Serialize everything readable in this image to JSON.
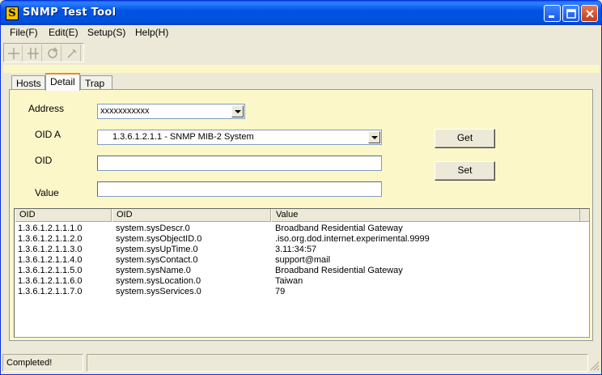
{
  "window": {
    "title": "SNMP Test Tool",
    "icon": "app-logo-icon"
  },
  "menu": [
    {
      "label": "File(F)"
    },
    {
      "label": "Edit(E)"
    },
    {
      "label": "Setup(S)"
    },
    {
      "label": "Help(H)"
    }
  ],
  "toolbar": {
    "icons": [
      "plus-icon",
      "hash-icon",
      "refresh-icon",
      "tool-icon"
    ]
  },
  "tabs": [
    {
      "label": "Hosts"
    },
    {
      "label": "Detail",
      "active": true
    },
    {
      "label": "Trap"
    }
  ],
  "form": {
    "address_label": "Address",
    "address_value": "xxxxxxxxxxx",
    "oida_label": "OID A",
    "oida_value": "1.3.6.1.2.1.1 - SNMP MIB-2 System",
    "oid_label": "OID",
    "oid_value": "",
    "value_label": "Value",
    "value_value": "",
    "get_label": "Get",
    "set_label": "Set"
  },
  "table": {
    "columns": [
      "OID",
      "OID",
      "Value"
    ],
    "rows": [
      [
        "1.3.6.1.2.1.1.1.0",
        "system.sysDescr.0",
        "Broadband Residential Gateway"
      ],
      [
        "1.3.6.1.2.1.1.2.0",
        "system.sysObjectID.0",
        ".iso.org.dod.internet.experimental.9999"
      ],
      [
        "1.3.6.1.2.1.1.3.0",
        "system.sysUpTime.0",
        "3.11:34:57"
      ],
      [
        "1.3.6.1.2.1.1.4.0",
        "system.sysContact.0",
        "support@mail"
      ],
      [
        "1.3.6.1.2.1.1.5.0",
        "system.sysName.0",
        "Broadband Residential Gateway"
      ],
      [
        "1.3.6.1.2.1.1.6.0",
        "system.sysLocation.0",
        "Taiwan"
      ],
      [
        "1.3.6.1.2.1.1.7.0",
        "system.sysServices.0",
        "79"
      ]
    ]
  },
  "status": {
    "text": "Completed!"
  },
  "colors": {
    "titlebar": "#0054e3",
    "panel": "#fcf7c9",
    "face": "#ece9d8"
  }
}
